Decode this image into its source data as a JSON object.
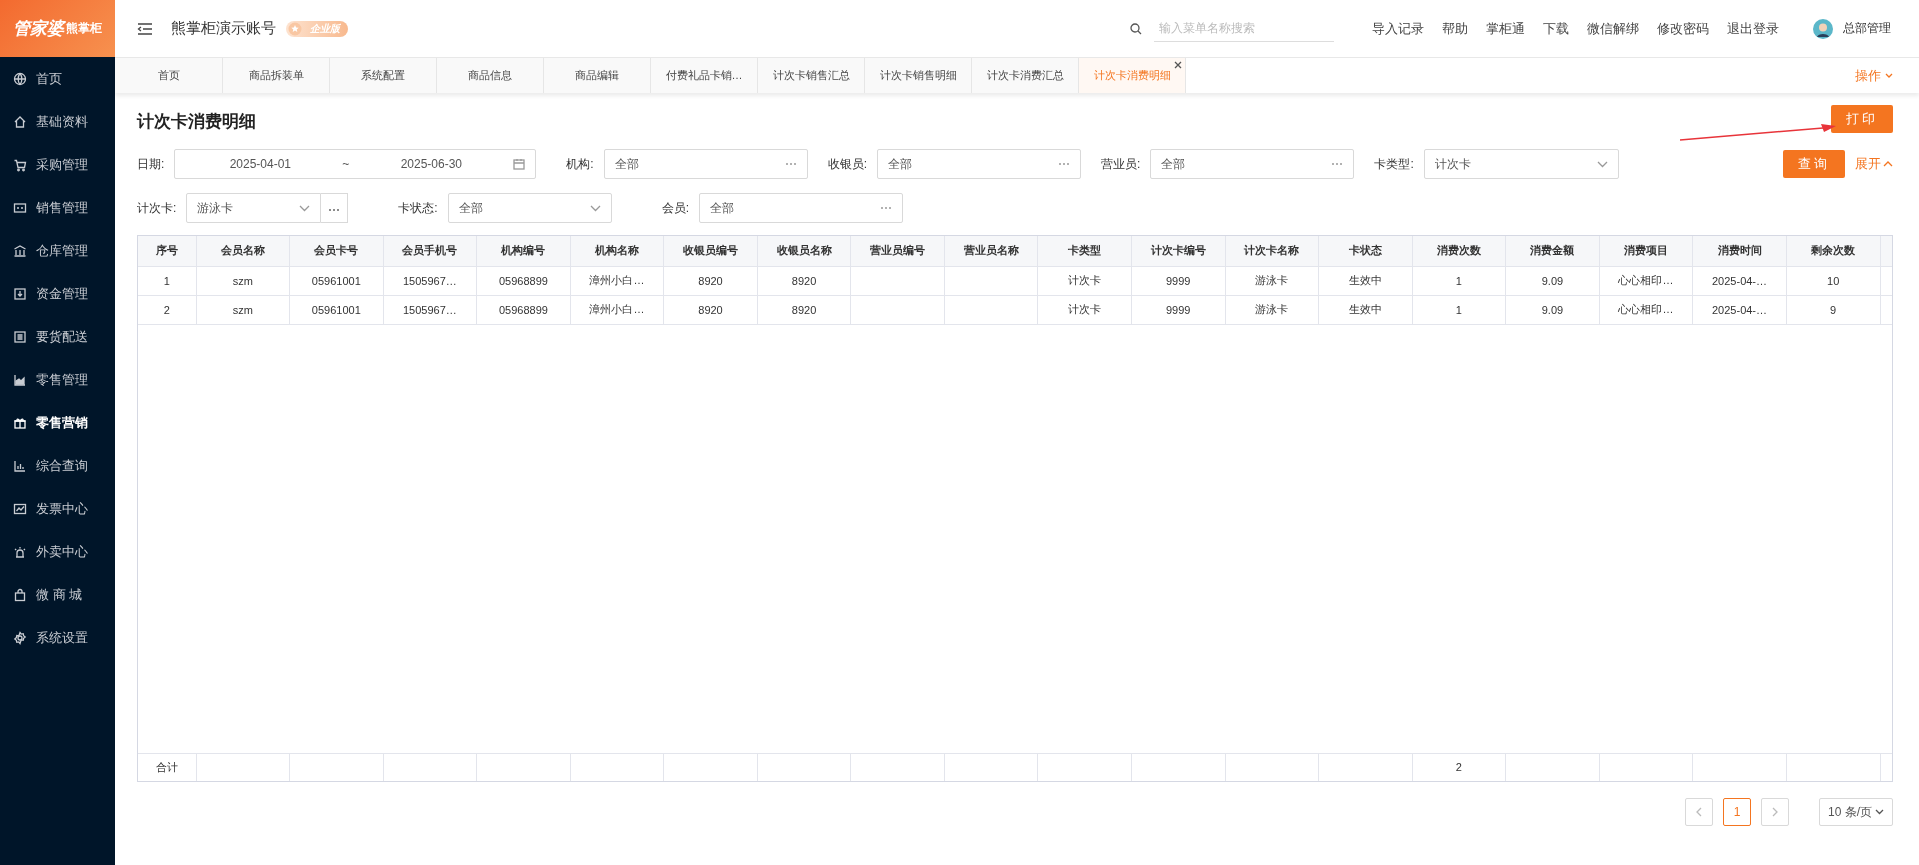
{
  "logo": {
    "brand": "管家婆",
    "product": "熊掌柜"
  },
  "header": {
    "account": "熊掌柜演示账号",
    "edition": "企业版",
    "search": {
      "placeholder": "输入菜单名称搜索"
    },
    "links": [
      "导入记录",
      "帮助",
      "掌柜通",
      "下载",
      "微信解绑",
      "修改密码",
      "退出登录"
    ],
    "user": "总部管理"
  },
  "sidebar": {
    "items": [
      {
        "label": "首页",
        "selected": false
      },
      {
        "label": "基础资料",
        "selected": false
      },
      {
        "label": "采购管理",
        "selected": false
      },
      {
        "label": "销售管理",
        "selected": false
      },
      {
        "label": "仓库管理",
        "selected": false
      },
      {
        "label": "资金管理",
        "selected": false
      },
      {
        "label": "要货配送",
        "selected": false
      },
      {
        "label": "零售管理",
        "selected": false
      },
      {
        "label": "零售营销",
        "selected": true
      },
      {
        "label": "综合查询",
        "selected": false
      },
      {
        "label": "发票中心",
        "selected": false
      },
      {
        "label": "外卖中心",
        "selected": false
      },
      {
        "label": "微 商 城",
        "selected": false
      },
      {
        "label": "系统设置",
        "selected": false
      }
    ]
  },
  "tabs": [
    {
      "label": "首页",
      "selected": false,
      "closable": false
    },
    {
      "label": "商品拆装单",
      "selected": false,
      "closable": false
    },
    {
      "label": "系统配置",
      "selected": false,
      "closable": false
    },
    {
      "label": "商品信息",
      "selected": false,
      "closable": false
    },
    {
      "label": "商品编辑",
      "selected": false,
      "closable": false
    },
    {
      "label": "付费礼品卡销…",
      "selected": false,
      "closable": false
    },
    {
      "label": "计次卡销售汇总",
      "selected": false,
      "closable": false
    },
    {
      "label": "计次卡销售明细",
      "selected": false,
      "closable": false
    },
    {
      "label": "计次卡消费汇总",
      "selected": false,
      "closable": false
    },
    {
      "label": "计次卡消费明细",
      "selected": true,
      "closable": true
    }
  ],
  "tab_actions": "操作",
  "page": {
    "title": "计次卡消费明细",
    "print_button": "打印"
  },
  "filters": [
    {
      "kind": "range",
      "label": "日期:",
      "start": "2025-04-01",
      "separator": "~",
      "end": "2025-06-30"
    },
    {
      "kind": "picker",
      "label": "机构:",
      "value": "全部"
    },
    {
      "kind": "picker",
      "label": "收银员:",
      "value": "全部"
    },
    {
      "kind": "picker",
      "label": "营业员:",
      "value": "全部"
    },
    {
      "kind": "select",
      "label": "卡类型:",
      "value": "计次卡"
    },
    {
      "kind": "select_picker",
      "label": "计次卡:",
      "value": "游泳卡"
    },
    {
      "kind": "select",
      "label": "卡状态:",
      "value": "全部"
    },
    {
      "kind": "picker",
      "label": "会员:",
      "value": "全部"
    }
  ],
  "query_button": "查询",
  "expand_link": "展开",
  "table": {
    "columns": [
      "序号",
      "会员名称",
      "会员卡号",
      "会员手机号",
      "机构编号",
      "机构名称",
      "收银员编号",
      "收银员名称",
      "营业员编号",
      "营业员名称",
      "卡类型",
      "计次卡编号",
      "计次卡名称",
      "卡状态",
      "消费次数",
      "消费金额",
      "消费项目",
      "消费时间",
      "剩余次数"
    ],
    "rows": [
      {
        "no": "1",
        "member_name": "szm",
        "member_card": "05961001",
        "member_phone": "1505967…",
        "org_code": "05968899",
        "org_name": "漳州小白…",
        "cashier_code": "8920",
        "cashier_name": "8920",
        "card_type": "计次卡",
        "card_code": "9999",
        "card_name": "游泳卡",
        "card_status": "生效中",
        "uses": "1",
        "amount": "9.09",
        "item": "心心相印…",
        "time": "2025-04-…",
        "remaining": "10"
      },
      {
        "no": "2",
        "member_name": "szm",
        "member_card": "05961001",
        "member_phone": "1505967…",
        "org_code": "05968899",
        "org_name": "漳州小白…",
        "cashier_code": "8920",
        "cashier_name": "8920",
        "card_type": "计次卡",
        "card_code": "9999",
        "card_name": "游泳卡",
        "card_status": "生效中",
        "uses": "1",
        "amount": "9.09",
        "item": "心心相印…",
        "time": "2025-04-…",
        "remaining": "9"
      }
    ],
    "footer": {
      "no": "合计",
      "uses": "2"
    }
  },
  "pagination": {
    "pages": [
      {
        "label": "1",
        "selected": true
      }
    ],
    "page_size": "10 条/页"
  }
}
